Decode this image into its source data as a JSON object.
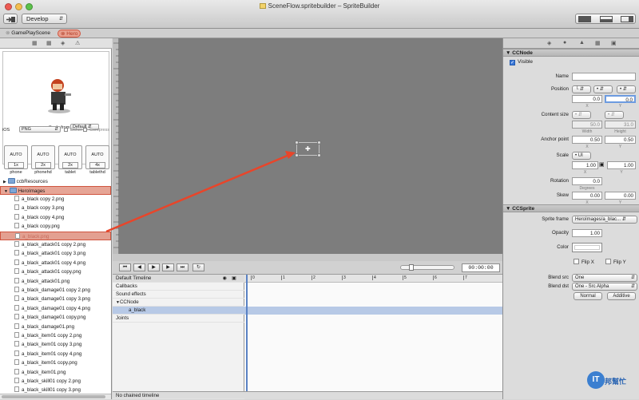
{
  "window": {
    "title": "SceneFlow.spritebuilder – SpriteBuilder",
    "publish_menu": "Develop"
  },
  "scene_tabs": [
    {
      "label": "GamePlayScene"
    },
    {
      "label": "Hero"
    }
  ],
  "preview": {
    "scale_from_label": "Scale from",
    "scale_from_value": "Default",
    "platform": "iOS",
    "format": "PNG",
    "dither_label": "Dither",
    "compress_label": "Compress"
  },
  "resolutions": [
    {
      "top": "AUTO",
      "mult": "1x",
      "name": "phone"
    },
    {
      "top": "AUTO",
      "mult": "2x",
      "name": "phonehd"
    },
    {
      "top": "AUTO",
      "mult": "2x",
      "name": "tablet"
    },
    {
      "top": "AUTO",
      "mult": "4x",
      "name": "tablethd"
    }
  ],
  "files": {
    "folders": [
      "ccbResources",
      "HeroImages"
    ],
    "items": [
      "a_black copy 2.png",
      "a_black copy 3.png",
      "a_black copy 4.png",
      "a_black copy.png",
      "a_black.png",
      "a_black_attack01 copy 2.png",
      "a_black_attack01 copy 3.png",
      "a_black_attack01 copy 4.png",
      "a_black_attack01 copy.png",
      "a_black_attack01.png",
      "a_black_damage01 copy 2.png",
      "a_black_damage01 copy 3.png",
      "a_black_damage01 copy 4.png",
      "a_black_damage01 copy.png",
      "a_black_damage01.png",
      "a_black_item01 copy 2.png",
      "a_black_item01 copy 3.png",
      "a_black_item01 copy 4.png",
      "a_black_item01 copy.png",
      "a_black_item01.png",
      "a_black_skill01 copy 2.png",
      "a_black_skill01 copy 3.png"
    ]
  },
  "ruler": {
    "h_ticks": [
      "0",
      "50",
      "100",
      "150",
      "200",
      "250",
      "300",
      "350",
      "400",
      "450",
      "500",
      "550",
      "600"
    ]
  },
  "timeline": {
    "time": "00:00:00",
    "name": "Default Timeline",
    "rows": [
      "Callbacks",
      "Sound effects",
      "CCNode",
      "a_black",
      "Joints"
    ],
    "scale_ticks": [
      "0",
      "1",
      "2",
      "3",
      "4",
      "5",
      "6",
      "7"
    ],
    "footer": "No chained timeline"
  },
  "inspector": {
    "ccnode": {
      "header": "CCNode",
      "visible_label": "Visible",
      "name_label": "Name",
      "name_value": "",
      "position_label": "Position",
      "pos_x": "0.0",
      "pos_y": "0.0",
      "x_label": "X",
      "y_label": "Y",
      "content_label": "Content size",
      "width_val": "50.0",
      "height_val": "31.0",
      "width_label": "Width",
      "height_label": "Height",
      "anchor_label": "Anchor point",
      "anchor_x": "0.50",
      "anchor_y": "0.50",
      "scale_label": "Scale",
      "scale_ui": "UI",
      "scale_x": "1.00",
      "scale_y": "1.00",
      "rotation_label": "Rotation",
      "rotation_val": "0.0",
      "degrees_label": "Degrees",
      "skew_label": "Skew",
      "skew_x": "0.00",
      "skew_y": "0.00"
    },
    "ccsprite": {
      "header": "CCSprite",
      "sprite_frame_label": "Sprite frame",
      "sprite_frame_value": "HeroImages/a_blac...",
      "opacity_label": "Opacity",
      "opacity_val": "1.00",
      "color_label": "Color",
      "flipx_label": "Flip X",
      "flipy_label": "Flip Y",
      "blend_src_label": "Blend src",
      "blend_src_val": "One",
      "blend_dst_label": "Blend dst",
      "blend_dst_val": "One - Src Alpha",
      "normal_btn": "Normal",
      "additive_btn": "Additive"
    }
  },
  "watermark": "IT邦幫忙",
  "colors": {
    "highlight": "#e07a6a",
    "arrow": "#e8452a",
    "selection": "#b7c9e6"
  }
}
